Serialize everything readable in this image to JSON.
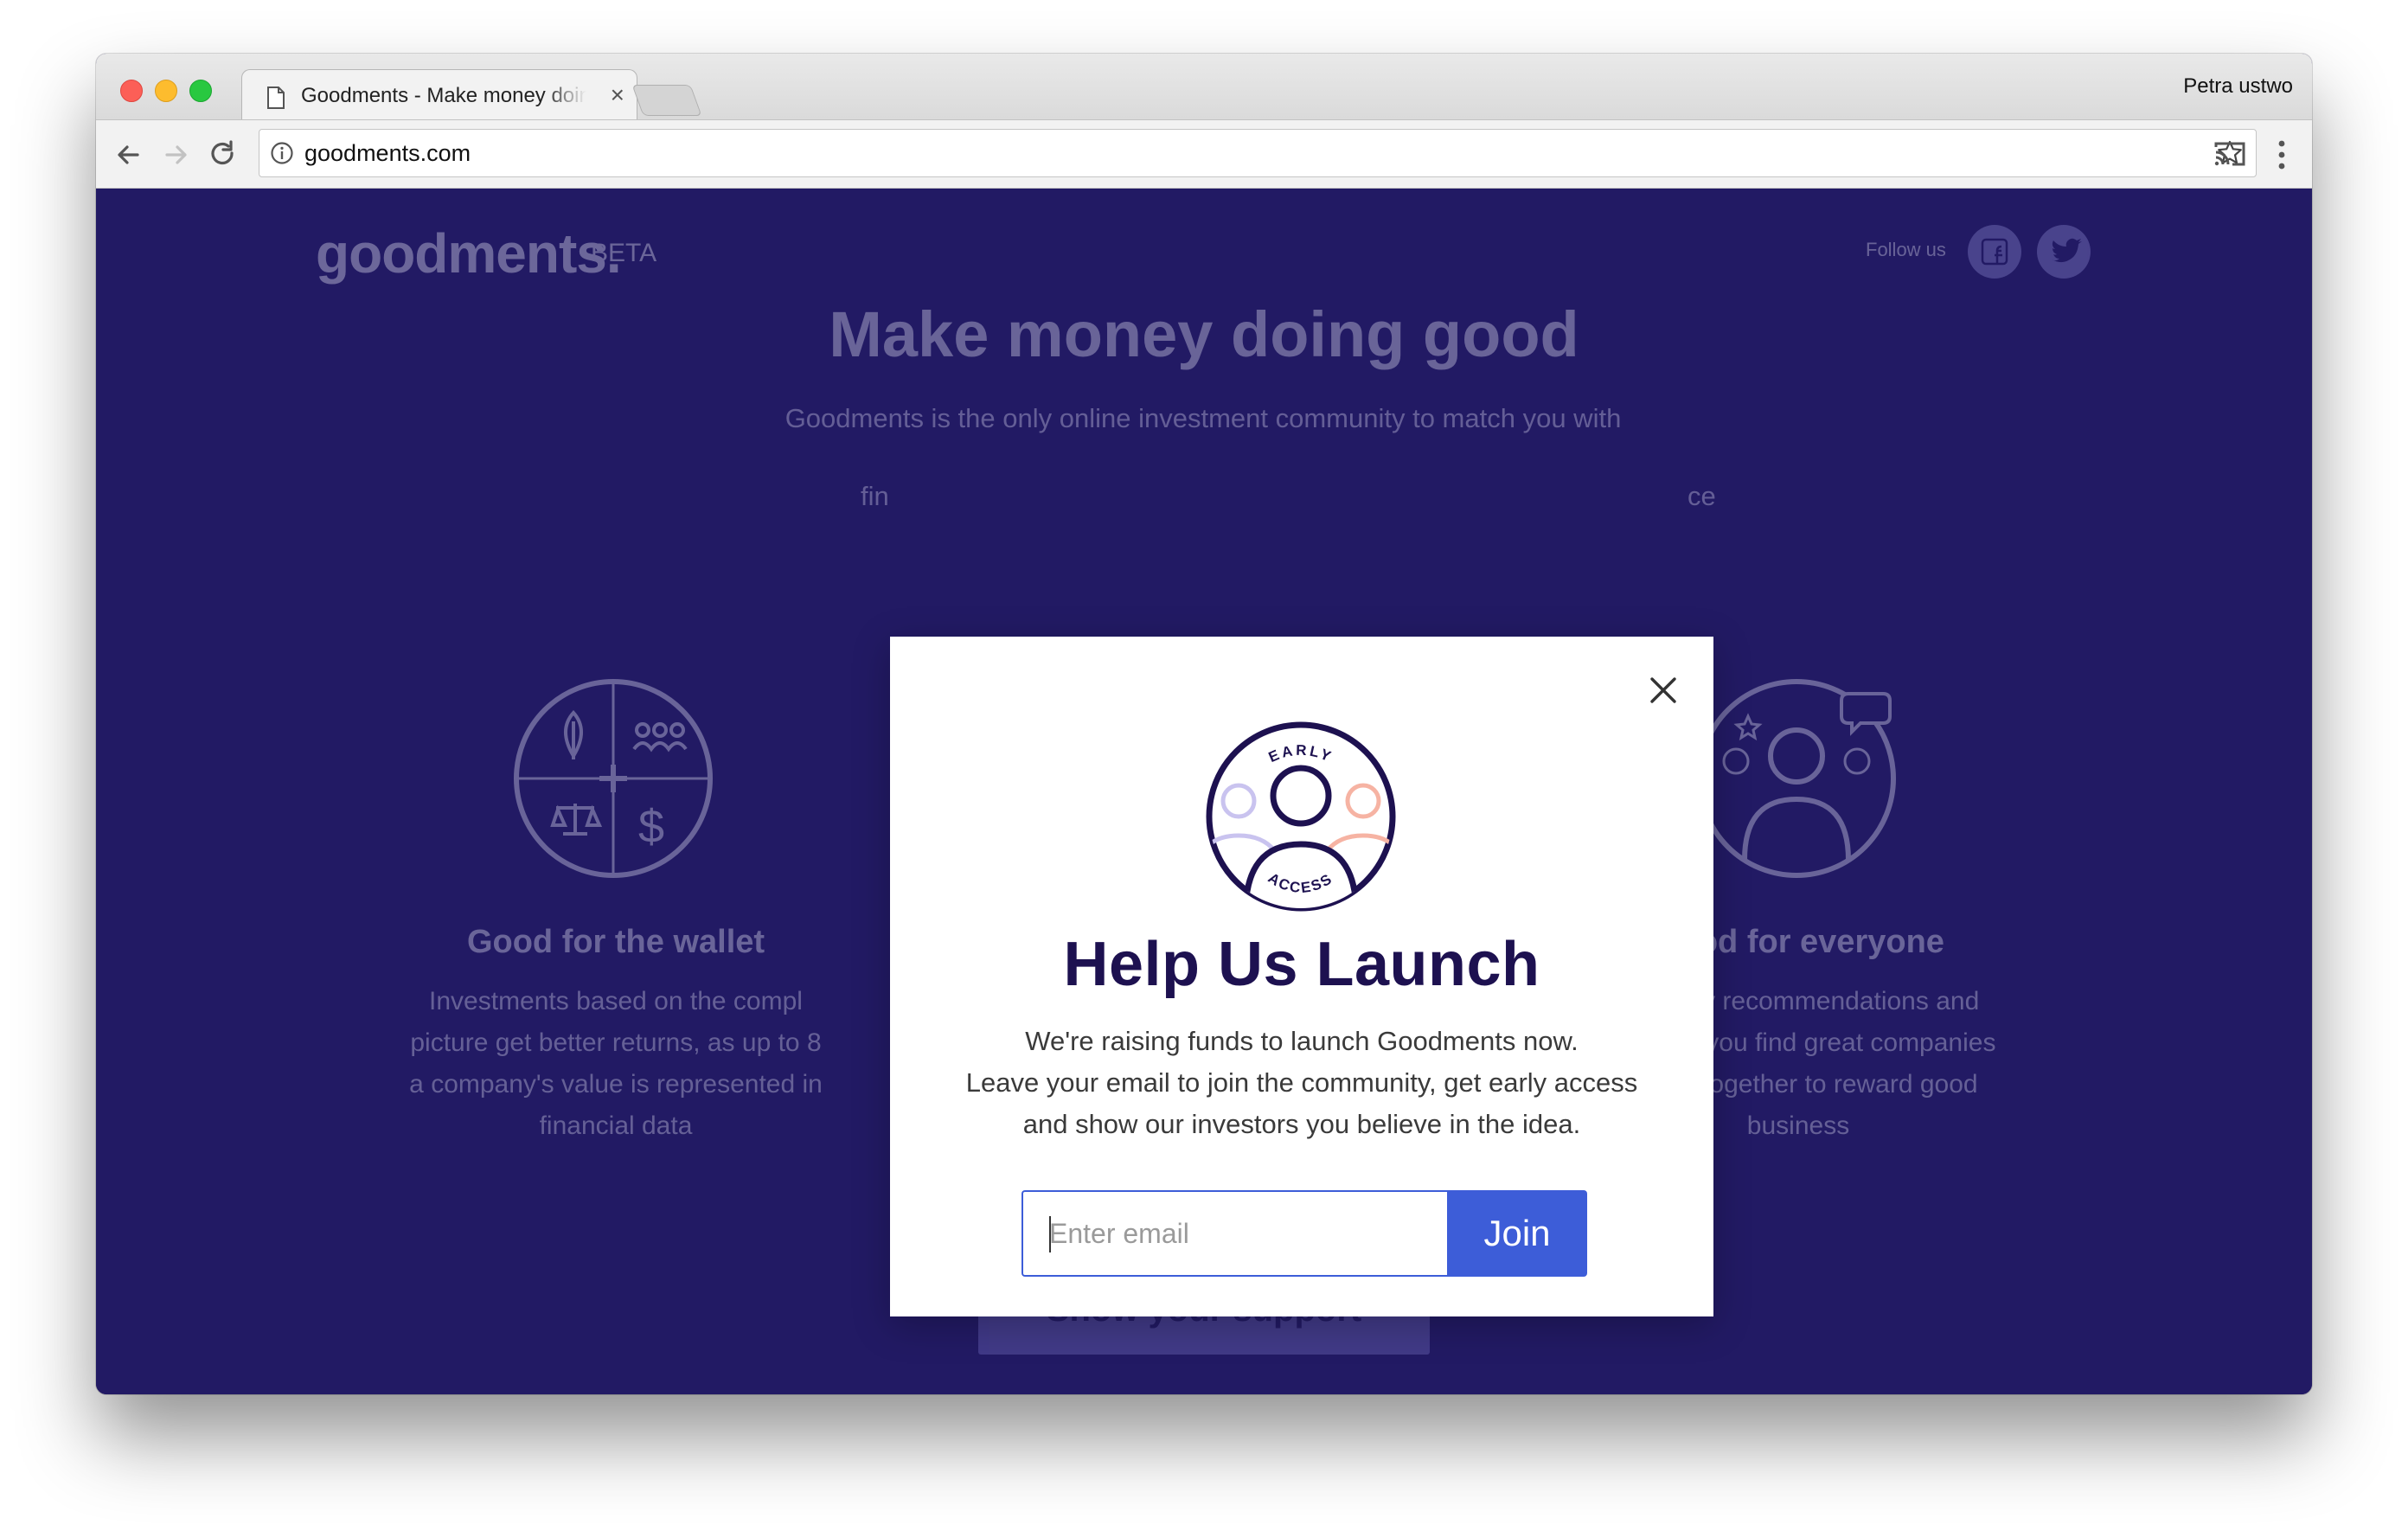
{
  "browser": {
    "tab_title": "Goodments - Make money doing good",
    "tab_close": "×",
    "profile_name": "Petra ustwo",
    "url": "goodments.com"
  },
  "page": {
    "logo": "goodments.",
    "beta": "BETA",
    "follow_label": "Follow us",
    "hero_title": "Make money doing good",
    "hero_subtitle_visible": [
      "Goodments is the only online investment community to match you with",
      "fin",
      "ce"
    ],
    "features": [
      {
        "title": "Good for the wallet",
        "text_visible": [
          "Investments based on the compl",
          "picture get better returns, as up to 8",
          "a company's value is represented in",
          "financial data"
        ]
      },
      {
        "title": "Good for everyone",
        "text_visible": [
          "mmunity recommendations and",
          "s to help you find great companies",
          "d work together to reward good",
          "business"
        ]
      }
    ],
    "support_button": "Show your support"
  },
  "modal": {
    "badge_top": "EARLY",
    "badge_bottom": "ACCESS",
    "title": "Help Us Launch",
    "text_lines": [
      "We're raising funds to launch Goodments now.",
      "Leave your email to join the community, get early access",
      "and show our investors you believe in the idea."
    ],
    "email_placeholder": "Enter email",
    "email_value": "",
    "join_label": "Join"
  },
  "colors": {
    "page_background": "#221a64",
    "modal_title": "#1d1150",
    "join_button": "#3d5dd8"
  },
  "icons": [
    "document-icon",
    "close-icon",
    "back-arrow-icon",
    "forward-arrow-icon",
    "reload-icon",
    "info-icon",
    "star-icon",
    "cast-icon",
    "menu-icon",
    "facebook-icon",
    "twitter-icon",
    "wallet-icon",
    "everyone-icon",
    "early-access-badge-icon"
  ]
}
